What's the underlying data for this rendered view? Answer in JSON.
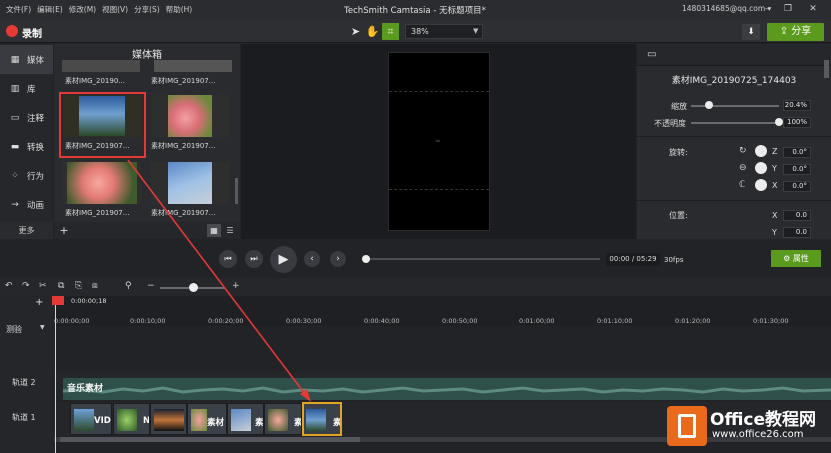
{
  "menubar": {
    "items": [
      "文件(F)",
      "编辑(E)",
      "修改(M)",
      "视图(V)",
      "分享(S)",
      "帮助(H)"
    ],
    "title": "TechSmith Camtasia - 无标题项目*",
    "account": "1480314685@qq.com ▾"
  },
  "toolbar": {
    "record": "录制",
    "zoom": "38%",
    "share": "分享",
    "download_icon": "⬇"
  },
  "left_tabs": [
    "媒体",
    "库",
    "注释",
    "转换",
    "行为",
    "动画"
  ],
  "more": "更多",
  "bin": {
    "title": "媒体箱",
    "items": [
      {
        "label": "素材IMG_20190..."
      },
      {
        "label": "素材IMG_201907..."
      },
      {
        "label": "素材IMG_201907..."
      },
      {
        "label": "素材IMG_201907..."
      },
      {
        "label": "素材IMG_201907..."
      },
      {
        "label": "素材IMG_201907..."
      }
    ]
  },
  "props": {
    "title": "素材IMG_20190725_174403",
    "scale_label": "缩放",
    "scale_value": "20.4%",
    "scale_level": 0.204,
    "opacity_label": "不透明度",
    "opacity_value": "100%",
    "opacity_level": 1.0,
    "rotate_label": "旋转:",
    "rot_z": "0.0°",
    "rot_y": "0.0°",
    "rot_x": "0.0°",
    "axis_z": "Z",
    "axis_y": "Y",
    "axis_x": "X",
    "pos_label": "位置:",
    "pos_x": "0.0",
    "pos_y": "0.0",
    "pos_axis_x": "X",
    "pos_axis_y": "Y"
  },
  "playback": {
    "time": "00:00 / 05:29",
    "fps": "30fps",
    "properties": "属性"
  },
  "timeline": {
    "playhead_time": "0:00:00;18",
    "ticks": [
      "0:00:00;00",
      "0:00:10;00",
      "0:00:20;00",
      "0:00:30;00",
      "0:00:40;00",
      "0:00:50;00",
      "0:01:00;00",
      "0:01:10;00",
      "0:01:20;00",
      "0:01:30;00"
    ],
    "tracks": [
      "测验",
      "轨道 2",
      "轨道 1"
    ],
    "audio_label": "音乐素材",
    "clips": [
      "VID",
      "",
      "N",
      "",
      "素材",
      "",
      "素",
      "素",
      "素"
    ]
  },
  "watermark": {
    "title": "Office教程网",
    "url": "www.office26.com"
  },
  "colors": {
    "accent_green": "#5a9a1d",
    "record_red": "#e53935",
    "selection": "#e2a424"
  }
}
